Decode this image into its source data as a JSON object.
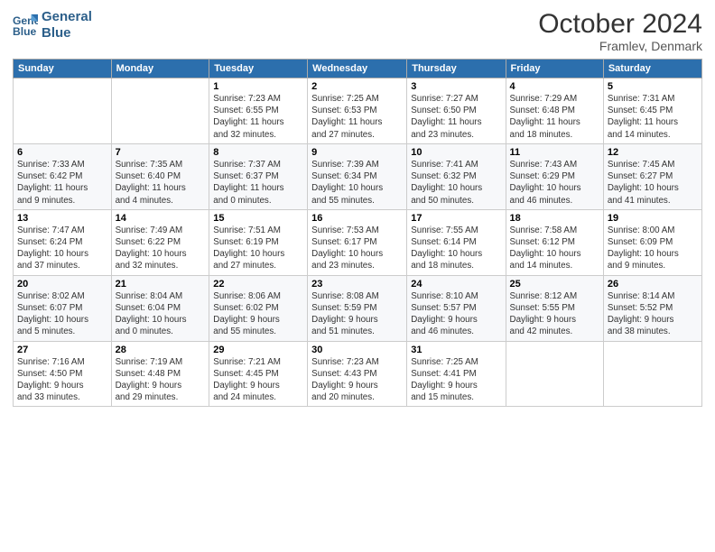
{
  "logo": {
    "line1": "General",
    "line2": "Blue"
  },
  "title": "October 2024",
  "subtitle": "Framlev, Denmark",
  "headers": [
    "Sunday",
    "Monday",
    "Tuesday",
    "Wednesday",
    "Thursday",
    "Friday",
    "Saturday"
  ],
  "weeks": [
    [
      {
        "day": "",
        "info": ""
      },
      {
        "day": "",
        "info": ""
      },
      {
        "day": "1",
        "info": "Sunrise: 7:23 AM\nSunset: 6:55 PM\nDaylight: 11 hours\nand 32 minutes."
      },
      {
        "day": "2",
        "info": "Sunrise: 7:25 AM\nSunset: 6:53 PM\nDaylight: 11 hours\nand 27 minutes."
      },
      {
        "day": "3",
        "info": "Sunrise: 7:27 AM\nSunset: 6:50 PM\nDaylight: 11 hours\nand 23 minutes."
      },
      {
        "day": "4",
        "info": "Sunrise: 7:29 AM\nSunset: 6:48 PM\nDaylight: 11 hours\nand 18 minutes."
      },
      {
        "day": "5",
        "info": "Sunrise: 7:31 AM\nSunset: 6:45 PM\nDaylight: 11 hours\nand 14 minutes."
      }
    ],
    [
      {
        "day": "6",
        "info": "Sunrise: 7:33 AM\nSunset: 6:42 PM\nDaylight: 11 hours\nand 9 minutes."
      },
      {
        "day": "7",
        "info": "Sunrise: 7:35 AM\nSunset: 6:40 PM\nDaylight: 11 hours\nand 4 minutes."
      },
      {
        "day": "8",
        "info": "Sunrise: 7:37 AM\nSunset: 6:37 PM\nDaylight: 11 hours\nand 0 minutes."
      },
      {
        "day": "9",
        "info": "Sunrise: 7:39 AM\nSunset: 6:34 PM\nDaylight: 10 hours\nand 55 minutes."
      },
      {
        "day": "10",
        "info": "Sunrise: 7:41 AM\nSunset: 6:32 PM\nDaylight: 10 hours\nand 50 minutes."
      },
      {
        "day": "11",
        "info": "Sunrise: 7:43 AM\nSunset: 6:29 PM\nDaylight: 10 hours\nand 46 minutes."
      },
      {
        "day": "12",
        "info": "Sunrise: 7:45 AM\nSunset: 6:27 PM\nDaylight: 10 hours\nand 41 minutes."
      }
    ],
    [
      {
        "day": "13",
        "info": "Sunrise: 7:47 AM\nSunset: 6:24 PM\nDaylight: 10 hours\nand 37 minutes."
      },
      {
        "day": "14",
        "info": "Sunrise: 7:49 AM\nSunset: 6:22 PM\nDaylight: 10 hours\nand 32 minutes."
      },
      {
        "day": "15",
        "info": "Sunrise: 7:51 AM\nSunset: 6:19 PM\nDaylight: 10 hours\nand 27 minutes."
      },
      {
        "day": "16",
        "info": "Sunrise: 7:53 AM\nSunset: 6:17 PM\nDaylight: 10 hours\nand 23 minutes."
      },
      {
        "day": "17",
        "info": "Sunrise: 7:55 AM\nSunset: 6:14 PM\nDaylight: 10 hours\nand 18 minutes."
      },
      {
        "day": "18",
        "info": "Sunrise: 7:58 AM\nSunset: 6:12 PM\nDaylight: 10 hours\nand 14 minutes."
      },
      {
        "day": "19",
        "info": "Sunrise: 8:00 AM\nSunset: 6:09 PM\nDaylight: 10 hours\nand 9 minutes."
      }
    ],
    [
      {
        "day": "20",
        "info": "Sunrise: 8:02 AM\nSunset: 6:07 PM\nDaylight: 10 hours\nand 5 minutes."
      },
      {
        "day": "21",
        "info": "Sunrise: 8:04 AM\nSunset: 6:04 PM\nDaylight: 10 hours\nand 0 minutes."
      },
      {
        "day": "22",
        "info": "Sunrise: 8:06 AM\nSunset: 6:02 PM\nDaylight: 9 hours\nand 55 minutes."
      },
      {
        "day": "23",
        "info": "Sunrise: 8:08 AM\nSunset: 5:59 PM\nDaylight: 9 hours\nand 51 minutes."
      },
      {
        "day": "24",
        "info": "Sunrise: 8:10 AM\nSunset: 5:57 PM\nDaylight: 9 hours\nand 46 minutes."
      },
      {
        "day": "25",
        "info": "Sunrise: 8:12 AM\nSunset: 5:55 PM\nDaylight: 9 hours\nand 42 minutes."
      },
      {
        "day": "26",
        "info": "Sunrise: 8:14 AM\nSunset: 5:52 PM\nDaylight: 9 hours\nand 38 minutes."
      }
    ],
    [
      {
        "day": "27",
        "info": "Sunrise: 7:16 AM\nSunset: 4:50 PM\nDaylight: 9 hours\nand 33 minutes."
      },
      {
        "day": "28",
        "info": "Sunrise: 7:19 AM\nSunset: 4:48 PM\nDaylight: 9 hours\nand 29 minutes."
      },
      {
        "day": "29",
        "info": "Sunrise: 7:21 AM\nSunset: 4:45 PM\nDaylight: 9 hours\nand 24 minutes."
      },
      {
        "day": "30",
        "info": "Sunrise: 7:23 AM\nSunset: 4:43 PM\nDaylight: 9 hours\nand 20 minutes."
      },
      {
        "day": "31",
        "info": "Sunrise: 7:25 AM\nSunset: 4:41 PM\nDaylight: 9 hours\nand 15 minutes."
      },
      {
        "day": "",
        "info": ""
      },
      {
        "day": "",
        "info": ""
      }
    ]
  ]
}
